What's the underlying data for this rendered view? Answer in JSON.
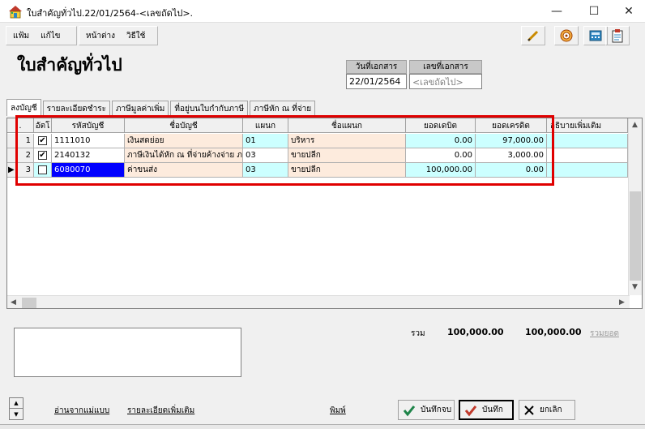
{
  "window": {
    "title": "ใบสำคัญทั่วไป.22/01/2564-<เลขถัดไป>.",
    "min": "—",
    "max": "☐",
    "close": "✕"
  },
  "menu": {
    "file": "แฟ้ม",
    "edit": "แก้ไข",
    "window": "หน้าต่าง",
    "help": "วิธีใช้"
  },
  "page_title": "ใบสำคัญทั่วไป",
  "doc_fields": {
    "date_label": "วันที่เอกสาร",
    "date_value": "22/01/2564",
    "docno_label": "เลขที่เอกสาร",
    "docno_placeholder": "<เลขถัดไป>"
  },
  "tabs": [
    "ลงบัญชี",
    "รายละเอียดชำระ",
    "ภาษีมูลค่าเพิ่ม",
    "ที่อยู่บนใบกำกับภาษี",
    "ภาษีหัก ณ ที่จ่าย"
  ],
  "grid": {
    "headers": {
      "seq": ".",
      "auto": "อัตโ",
      "account_code": "รหัสบัญชี",
      "account_name": "ชื่อบัญชี",
      "dept": "แผนก",
      "dept_name": "ชื่อแผนก",
      "debit": "ยอดเดบิต",
      "credit": "ยอดเครดิต",
      "description": "อธิบายเพิ่มเติม"
    },
    "rows": [
      {
        "seq": "1",
        "checked": true,
        "account_code": "1111010",
        "account_name": "เงินสดย่อย",
        "dept": "01",
        "dept_name": "บริหาร",
        "debit": "0.00",
        "credit": "97,000.00"
      },
      {
        "seq": "2",
        "checked": true,
        "account_code": "2140132",
        "account_name": "ภาษีเงินได้หัก ณ ที่จ่ายค้างจ่าย ภ",
        "dept": "03",
        "dept_name": "ขายปลีก",
        "debit": "0.00",
        "credit": "3,000.00"
      },
      {
        "seq": "3",
        "checked": false,
        "account_code": "6080070",
        "account_name": "ค่าขนส่ง",
        "dept": "03",
        "dept_name": "ขายปลีก",
        "debit": "100,000.00",
        "credit": "0.00"
      }
    ]
  },
  "totals": {
    "label": "รวม",
    "debit": "100,000.00",
    "credit": "100,000.00",
    "sum_link": "รวมยอด"
  },
  "bottom_links": {
    "from_template": "อ่านจากแม่แบบ",
    "more_details": "รายละเอียดเพิ่มเติม",
    "print": "พิมพ์"
  },
  "buttons": {
    "save_close": "บันทึกจบ",
    "save": "บันทึก",
    "cancel": "ยกเลิก"
  },
  "colors": {
    "highlight_frame": "#e00000",
    "row_cyan": "#ccffff",
    "row_peach": "#fdebdd",
    "selected_cell": "#0000ff"
  }
}
